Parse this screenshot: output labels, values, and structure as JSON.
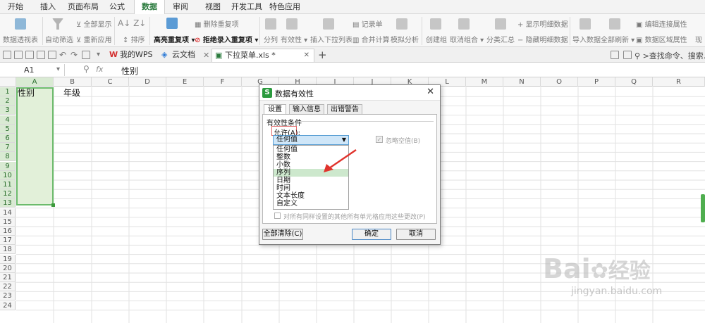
{
  "menu": {
    "tabs": [
      "开始",
      "插入",
      "页面布局",
      "公式",
      "数据",
      "审阅",
      "视图",
      "开发工具",
      "特色应用"
    ],
    "active": "数据"
  },
  "ribbon": {
    "pivot": "数据透视表",
    "autofilter": "自动筛选",
    "show_all": "全部显示",
    "reapply": "重新应用",
    "sort": "排序",
    "highlight_dup": "高亮重复项",
    "delete_dup": "删除重复项",
    "reject_dup": "拒绝录入重复项",
    "split": "分列",
    "validity": "有效性",
    "insert_dropdown": "插入下拉列表",
    "record": "记录单",
    "merge_calc": "合并计算",
    "simulate": "模拟分析",
    "create_group": "创建组",
    "cancel_group": "取消组合",
    "subtotal": "分类汇总",
    "show_detail": "显示明细数据",
    "hide_detail": "隐藏明细数据",
    "import_data": "导入数据",
    "refresh_all": "全部刷新",
    "edit_conn": "编辑连接属性",
    "area_prop": "数据区域属性",
    "more": "现"
  },
  "quickbar": {
    "tabs": [
      {
        "label": "我的WPS"
      },
      {
        "label": "云文档"
      },
      {
        "label": "下拉菜单.xls *"
      }
    ],
    "search_placeholder": "查找命令、搜索...",
    "search_prefix": ">"
  },
  "formula": {
    "cell_ref": "A1",
    "fx": "fx",
    "value": "性别"
  },
  "sheet": {
    "columns": [
      "A",
      "B",
      "C",
      "D",
      "E",
      "F",
      "G",
      "H",
      "I",
      "J",
      "K",
      "L",
      "M",
      "N",
      "O",
      "P",
      "Q",
      "R"
    ],
    "rows": [
      "1",
      "2",
      "3",
      "4",
      "5",
      "6",
      "7",
      "8",
      "9",
      "10",
      "11",
      "12",
      "13",
      "14",
      "15",
      "16",
      "17",
      "18",
      "19",
      "20",
      "21",
      "22",
      "23",
      "24"
    ],
    "a1": "性别",
    "b1": "年级"
  },
  "dialog": {
    "title": "数据有效性",
    "tabs": [
      "设置",
      "输入信息",
      "出错警告"
    ],
    "group_label": "有效性条件",
    "allow_label": "允许(A):",
    "selected": "任何值",
    "options": [
      "任何值",
      "整数",
      "小数",
      "序列",
      "日期",
      "时间",
      "文本长度",
      "自定义"
    ],
    "ignore_blank": "忽略空值(B)",
    "apply_all": "对所有同样设置的其他所有单元格应用这些更改(P)",
    "clear_all": "全部清除(C)",
    "ok": "确定",
    "cancel": "取消"
  },
  "watermark": {
    "brand": "Bai",
    "brand2": "经验",
    "url": "jingyan.baidu.com"
  },
  "colors": {
    "accent_green": "#2b7b3e",
    "selection_fill": "#e2f0d9",
    "dropdown_highlight": "#cde8cd",
    "arrow_red": "#e0332c"
  }
}
